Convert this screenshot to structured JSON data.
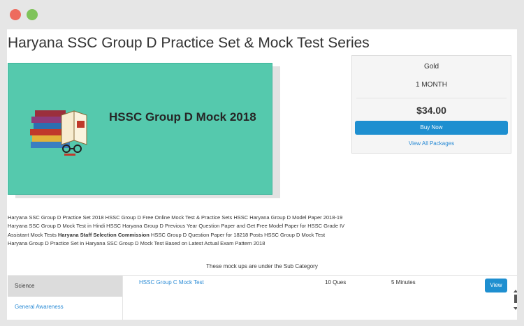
{
  "page": {
    "title": "Haryana SSC Group D Practice Set & Mock Test Series"
  },
  "banner": {
    "heading": "HSSC Group D Mock  2018",
    "background_color": "#55c9ad"
  },
  "description": {
    "line1": "Haryana SSC Group D Practice Set 2018 HSSC Group D Free Online Mock Test & Practice Sets HSSC Haryana Group D Model Paper 2018-19",
    "line2": "Haryana SSC Group D Mock Test in Hindi HSSC Haryana Group D Previous Year Question Paper and Get Free Model Paper for HSSC Grade IV",
    "line3_start": "Assistant Mock Tests ",
    "line3_bold": "Haryana Staff Selection Commission",
    "line3_end": " HSSC Group D Question Paper for 18218 Posts HSSC Group D Mock Test",
    "line4": "Haryana Group D Practice Set in Haryana SSC Group D Mock Test Based on Latest Actual Exam Pattern 2018"
  },
  "package": {
    "name": "Gold",
    "duration": "1 MONTH",
    "price": "$34.00",
    "buy_label": "Buy Now",
    "view_all_label": "View All Packages",
    "accent_color": "#1e8fd0"
  },
  "subcategory": {
    "notice": "These mock ups are under the Sub Category",
    "sidebar": [
      {
        "label": "Science"
      },
      {
        "label": "General Awareness"
      }
    ],
    "tests": [
      {
        "name": "HSSC Group C Mock Test",
        "questions": "10 Ques",
        "duration": "5 Minutes",
        "action": "View"
      }
    ]
  },
  "icons": {
    "window_close": "red-dot-icon",
    "window_zoom": "green-dot-icon",
    "banner_art": "books-and-glasses-icon"
  }
}
